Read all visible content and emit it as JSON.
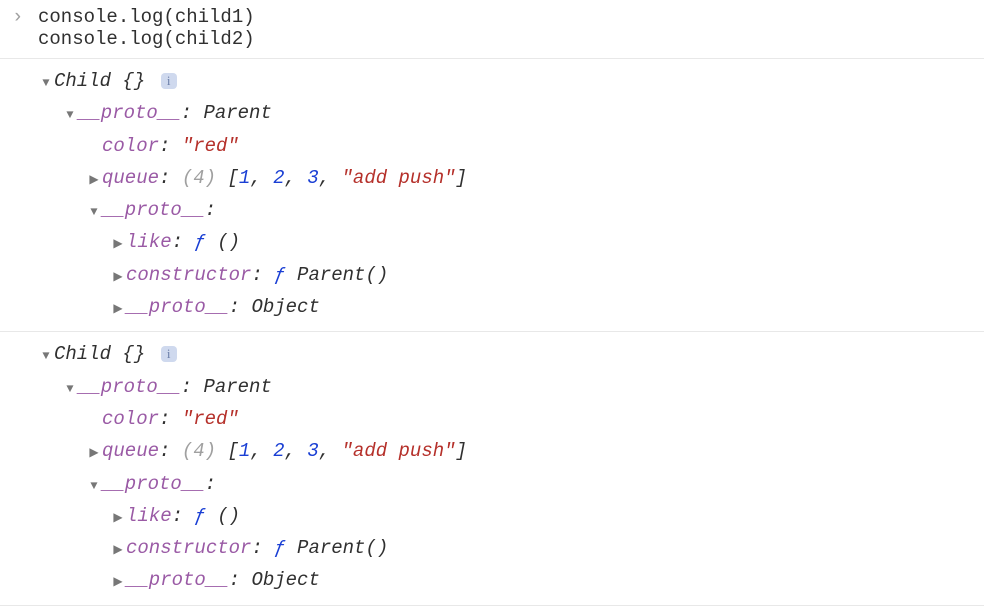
{
  "input": {
    "lines": [
      "console.log(child1)",
      "console.log(child2)"
    ]
  },
  "objects": [
    {
      "header": {
        "class": "Child",
        "suffix": " {}"
      },
      "proto1_label": "__proto__",
      "proto1_value": "Parent",
      "props": {
        "color_key": "color",
        "color_val": "\"red\"",
        "queue_key": "queue",
        "queue_len": "(4)",
        "queue_open": " [",
        "queue_close": "]",
        "queue_items": [
          {
            "text": "1",
            "cls": "val-blue"
          },
          {
            "text": ", ",
            "cls": "val-black"
          },
          {
            "text": "2",
            "cls": "val-blue"
          },
          {
            "text": ", ",
            "cls": "val-black"
          },
          {
            "text": "3",
            "cls": "val-blue"
          },
          {
            "text": ", ",
            "cls": "val-black"
          },
          {
            "text": "\"add push\"",
            "cls": "val-red"
          }
        ]
      },
      "proto2_label": "__proto__",
      "proto2_after": ":",
      "inner": {
        "like_key": "like",
        "like_val_f": "ƒ",
        "like_val_paren": " ()",
        "ctor_key": "constructor",
        "ctor_val_f": "ƒ",
        "ctor_val_name": " Parent()",
        "proto3_key": "__proto__",
        "proto3_val": "Object"
      }
    },
    {
      "header": {
        "class": "Child",
        "suffix": " {}"
      },
      "proto1_label": "__proto__",
      "proto1_value": "Parent",
      "props": {
        "color_key": "color",
        "color_val": "\"red\"",
        "queue_key": "queue",
        "queue_len": "(4)",
        "queue_open": " [",
        "queue_close": "]",
        "queue_items": [
          {
            "text": "1",
            "cls": "val-blue"
          },
          {
            "text": ", ",
            "cls": "val-black"
          },
          {
            "text": "2",
            "cls": "val-blue"
          },
          {
            "text": ", ",
            "cls": "val-black"
          },
          {
            "text": "3",
            "cls": "val-blue"
          },
          {
            "text": ", ",
            "cls": "val-black"
          },
          {
            "text": "\"add push\"",
            "cls": "val-red"
          }
        ]
      },
      "proto2_label": "__proto__",
      "proto2_after": ":",
      "inner": {
        "like_key": "like",
        "like_val_f": "ƒ",
        "like_val_paren": " ()",
        "ctor_key": "constructor",
        "ctor_val_f": "ƒ",
        "ctor_val_name": " Parent()",
        "proto3_key": "__proto__",
        "proto3_val": "Object"
      }
    }
  ],
  "glyphs": {
    "down": "▼",
    "right": "▶",
    "info": "i",
    "prompt": "›"
  }
}
